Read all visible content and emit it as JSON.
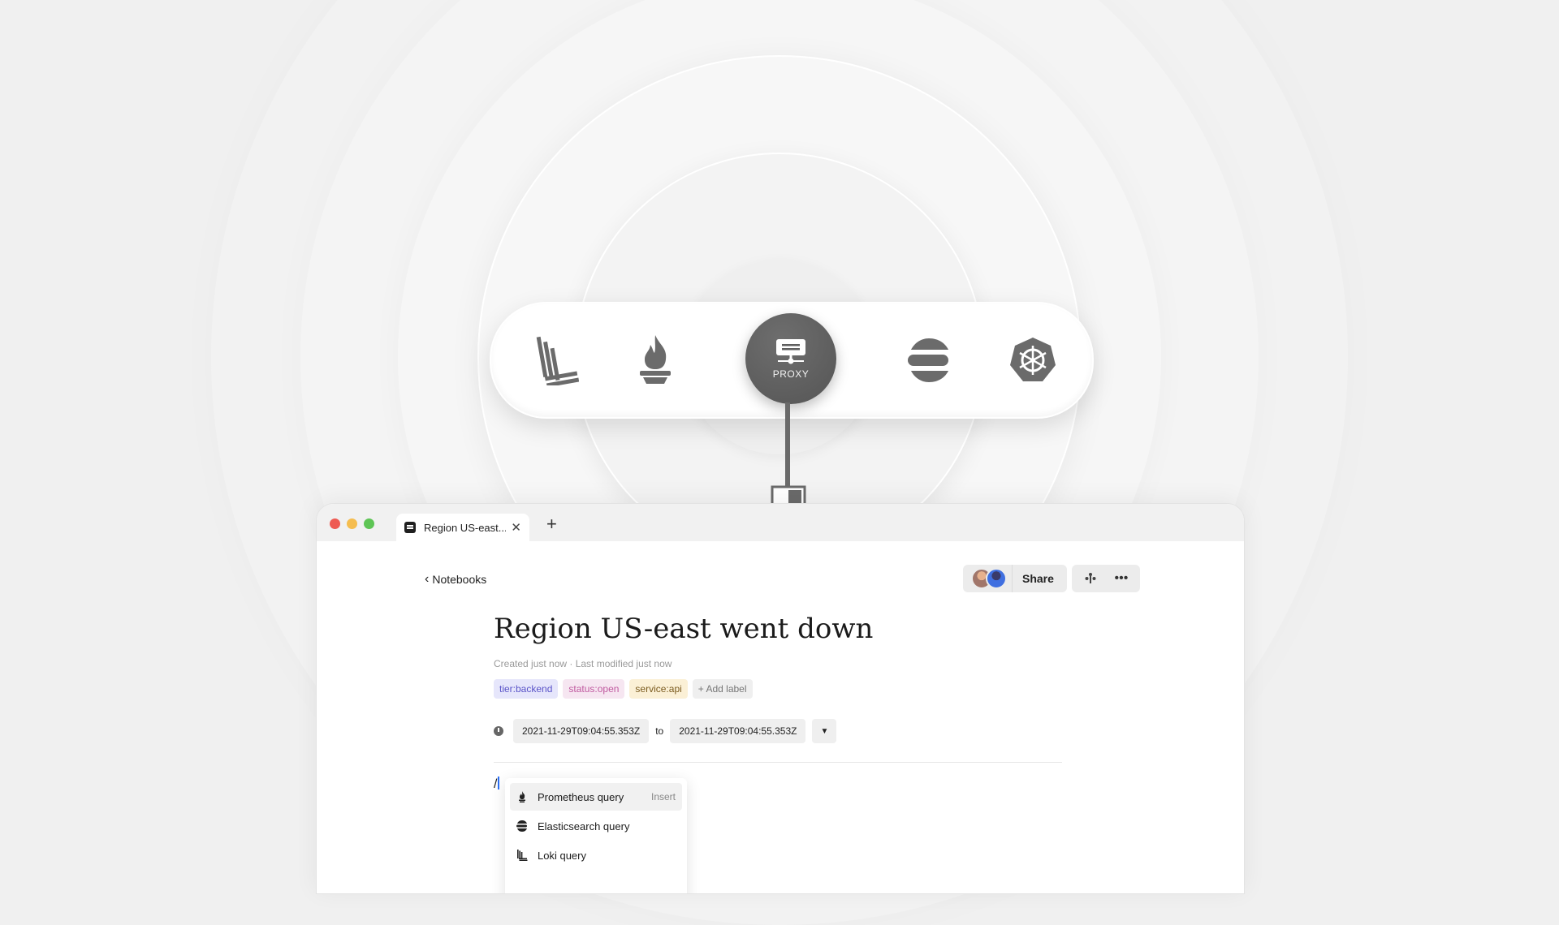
{
  "datasources": {
    "items": [
      {
        "name": "loki",
        "icon": "loki-icon"
      },
      {
        "name": "prometheus",
        "icon": "prometheus-icon"
      },
      {
        "name": "proxy",
        "icon": "proxy-server-icon",
        "label": "PROXY"
      },
      {
        "name": "elasticsearch",
        "icon": "elasticsearch-icon"
      },
      {
        "name": "kubernetes",
        "icon": "kubernetes-icon"
      }
    ],
    "shield_icon": "shield-icon"
  },
  "browser": {
    "tab_title": "Region US-east...",
    "close_glyph": "✕",
    "new_tab_glyph": "+"
  },
  "header": {
    "back_label": "Notebooks",
    "share_label": "Share",
    "more_glyph": "•••"
  },
  "notebook": {
    "title": "Region US-east went down",
    "meta": "Created just now · Last modified just now",
    "labels": [
      "tier:backend",
      "status:open",
      "service:api",
      "+ Add label"
    ],
    "time_from": "2021-11-29T09:04:55.353Z",
    "time_to_word": "to",
    "time_to": "2021-11-29T09:04:55.353Z",
    "editor_text": "/"
  },
  "command_menu": {
    "items": [
      {
        "label": "Prometheus query",
        "hint": "Insert",
        "icon": "prometheus-icon"
      },
      {
        "label": "Elasticsearch query",
        "hint": "",
        "icon": "elasticsearch-icon"
      },
      {
        "label": "Loki query",
        "hint": "",
        "icon": "loki-icon"
      }
    ]
  },
  "colors": {
    "background": "#f0f0f0",
    "proxy_node": "#5e5e5e",
    "label_backend": "#5a54c8",
    "label_status": "#c05aa0",
    "label_service": "#7a5a1e",
    "caret": "#2a6ff5"
  }
}
